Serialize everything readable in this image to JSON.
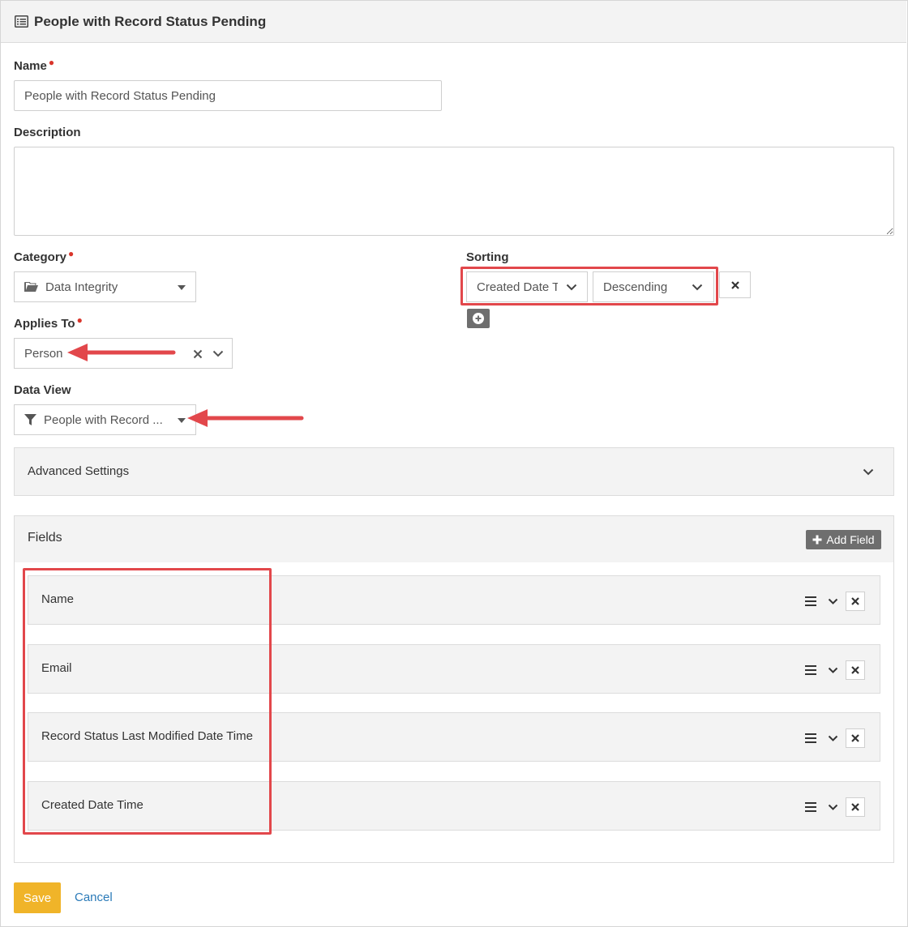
{
  "header": {
    "title": "People with Record Status Pending",
    "icon": "list-icon"
  },
  "name": {
    "label": "Name",
    "value": "People with Record Status Pending"
  },
  "description": {
    "label": "Description",
    "value": ""
  },
  "category": {
    "label": "Category",
    "value": "Data Integrity",
    "icon": "folder-open-icon"
  },
  "sorting": {
    "label": "Sorting",
    "field": "Created Date T",
    "direction": "Descending"
  },
  "applies_to": {
    "label": "Applies To",
    "value": "Person"
  },
  "data_view": {
    "label": "Data View",
    "value": "People with Record ...",
    "icon": "filter-icon"
  },
  "advanced": {
    "label": "Advanced Settings"
  },
  "fields": {
    "label": "Fields",
    "add_label": "Add Field",
    "items": [
      {
        "label": "Name"
      },
      {
        "label": "Email"
      },
      {
        "label": "Record Status Last Modified Date Time"
      },
      {
        "label": "Created Date Time"
      }
    ]
  },
  "actions": {
    "save": "Save",
    "cancel": "Cancel"
  },
  "colors": {
    "accent": "#f0b429",
    "link": "#2a7ab8",
    "annotation": "#e2474b",
    "required": "#d9352b"
  }
}
